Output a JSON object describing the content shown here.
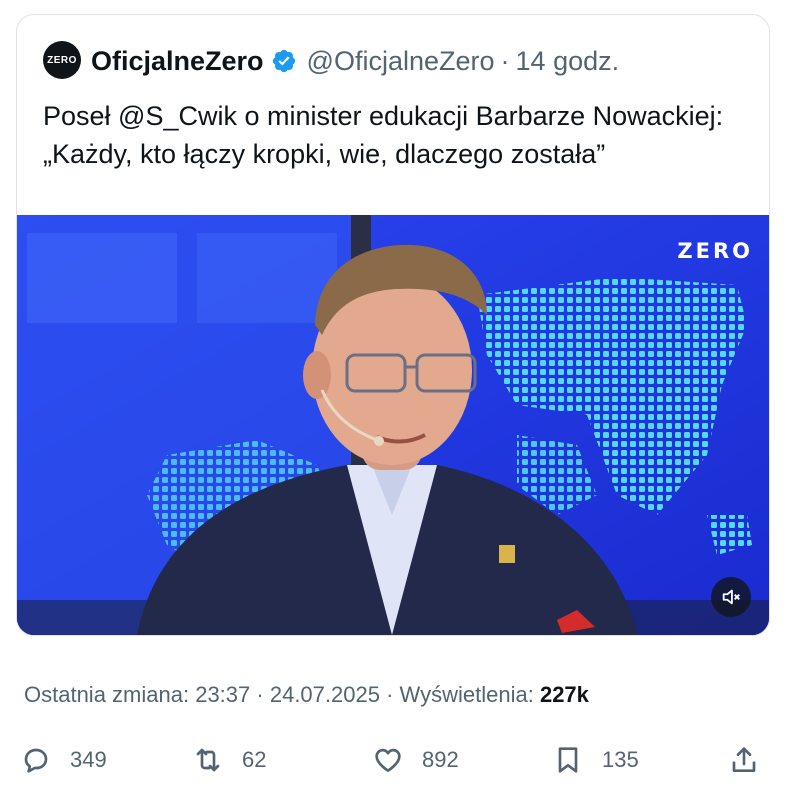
{
  "tweet": {
    "avatar_text": "ZERO",
    "display_name": "OficjalneZero",
    "handle": "@OficjalneZero",
    "separator": "·",
    "time": "14 godz.",
    "text": "Poseł @S_Cwik o minister edukacji Barbarze Nowackiej: „Każdy, kto łączy kropki, wie, dlaczego została”"
  },
  "media": {
    "channel_logo": "ZERO",
    "mute_icon": "speaker-muted-icon"
  },
  "meta": {
    "edited_label": "Ostatnia zmiana:",
    "edited_time": "23:37",
    "separator": "·",
    "edited_date": "24.07.2025",
    "views_label": "Wyświetlenia:",
    "views_count": "227k"
  },
  "actions": {
    "replies": "349",
    "reposts": "62",
    "likes": "892",
    "bookmarks": "135"
  },
  "colors": {
    "verified": "#1d9bf0",
    "text_primary": "#0f1419",
    "text_secondary": "#536471",
    "studio_blue": "#1e33e0"
  }
}
